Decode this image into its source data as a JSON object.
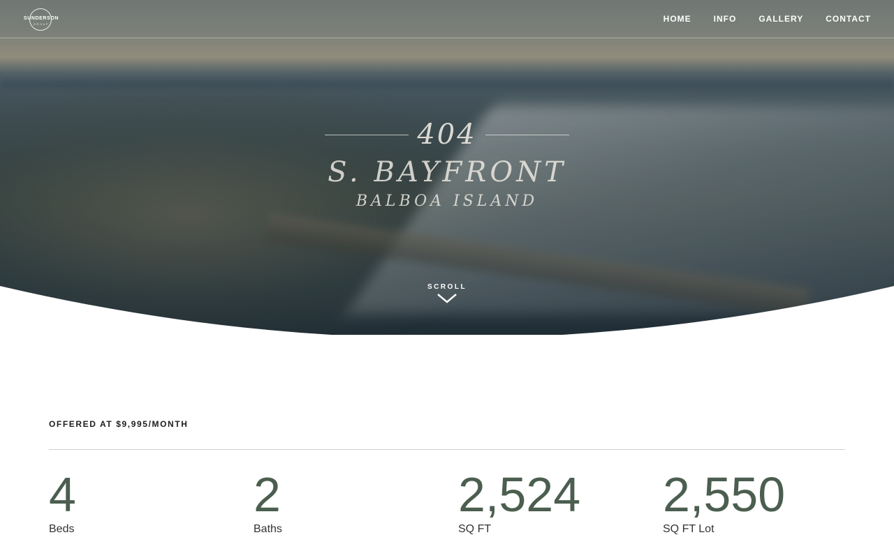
{
  "logo": {
    "text": "SUNDERSON",
    "subtext": "GROUP"
  },
  "nav": {
    "items": [
      {
        "label": "HOME"
      },
      {
        "label": "INFO"
      },
      {
        "label": "GALLERY"
      },
      {
        "label": "CONTACT"
      }
    ]
  },
  "hero": {
    "number": "404",
    "street": "S. BAYFRONT",
    "area": "BALBOA ISLAND",
    "scroll_label": "SCROLL",
    "scroll_icon": "chevron-down-icon"
  },
  "listing": {
    "offer": "OFFERED AT $9,995/MONTH",
    "stats": [
      {
        "value": "4",
        "label": "Beds"
      },
      {
        "value": "2",
        "label": "Baths"
      },
      {
        "value": "2,524",
        "label": "SQ FT"
      },
      {
        "value": "2,550",
        "label": "SQ FT Lot"
      }
    ]
  },
  "colors": {
    "accent": "#4b5e4f",
    "text": "#1d1d1d",
    "divider": "#cfcfcf"
  }
}
